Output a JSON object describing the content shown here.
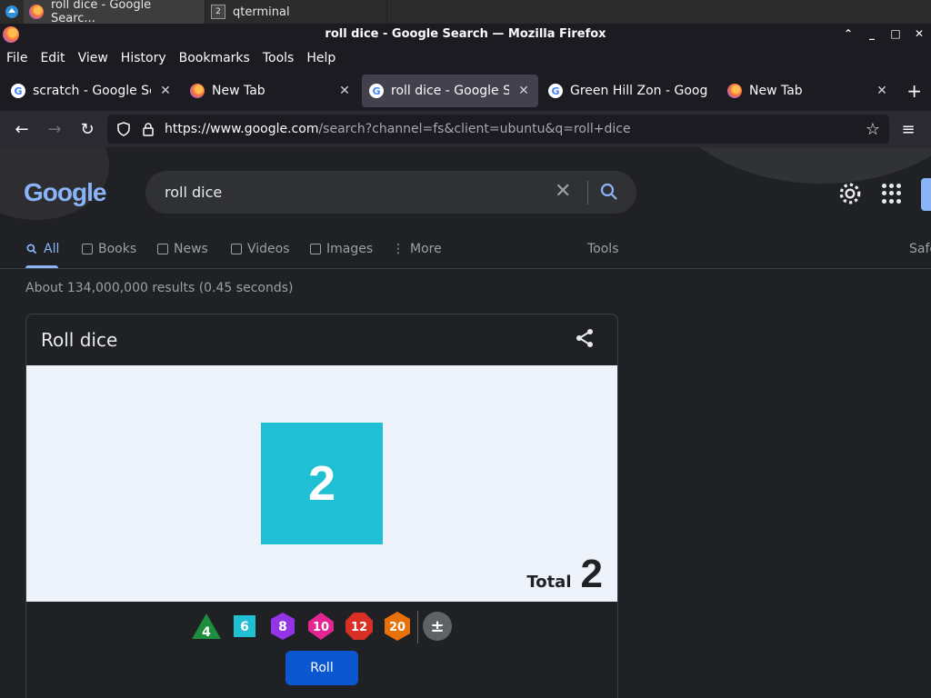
{
  "taskbar": {
    "tasks": [
      {
        "label": "roll dice - Google Searc..."
      },
      {
        "label": "qterminal"
      }
    ]
  },
  "window": {
    "title": "roll dice - Google Search — Mozilla Firefox"
  },
  "menu": [
    "File",
    "Edit",
    "View",
    "History",
    "Bookmarks",
    "Tools",
    "Help"
  ],
  "tabs": [
    {
      "label": "scratch - Google Sea",
      "icon": "google-icon"
    },
    {
      "label": "New Tab",
      "icon": "firefox-icon"
    },
    {
      "label": "roll dice - Google Sea",
      "icon": "google-icon",
      "active": true
    },
    {
      "label": "Green Hill Zon - Goog",
      "icon": "google-icon"
    },
    {
      "label": "New Tab",
      "icon": "firefox-icon"
    }
  ],
  "url": {
    "domain": "https://www.google.com",
    "path": "/search?channel=fs&client=ubuntu&q=roll+dice"
  },
  "search": {
    "query": "roll dice",
    "logo": "Google"
  },
  "navtabs": [
    "All",
    "Books",
    "News",
    "Videos",
    "Images",
    "More",
    "Tools",
    "Safe"
  ],
  "stats": "About 134,000,000 results (0.45 seconds)",
  "card": {
    "title": "Roll dice",
    "die_value": "2",
    "total_label": "Total",
    "total_value": "2",
    "dice": [
      {
        "label": "4",
        "color": "#1e8e3e"
      },
      {
        "label": "6",
        "color": "#1fbfd4"
      },
      {
        "label": "8",
        "color": "#9334e6"
      },
      {
        "label": "10",
        "color": "#e52592"
      },
      {
        "label": "12",
        "color": "#d93025"
      },
      {
        "label": "20",
        "color": "#e8710a"
      },
      {
        "label": "±",
        "color": "#5f6368"
      }
    ],
    "roll_label": "Roll"
  }
}
